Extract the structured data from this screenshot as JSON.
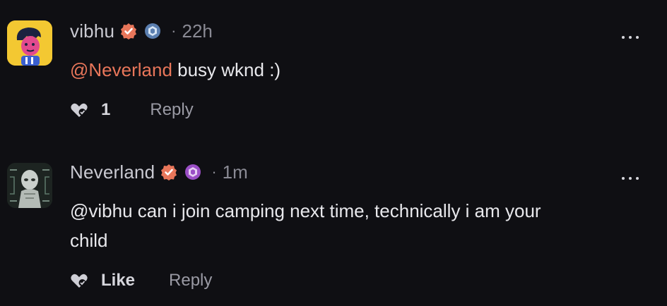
{
  "comments": [
    {
      "author": "vibhu",
      "badges": [
        "verified-orange-badge",
        "hexagon-blue-badge"
      ],
      "separator": "·",
      "time": "22h",
      "mention": "@Neverland",
      "text": " busy wknd :)",
      "like_label": "1",
      "reply_label": "Reply",
      "more_icon": "ellipsis-icon"
    },
    {
      "author": "Neverland",
      "badges": [
        "verified-orange-badge",
        "hexagon-purple-badge"
      ],
      "separator": "·",
      "time": "1m",
      "mention": "@vibhu",
      "text": " can i join camping next time, technically i am your child",
      "like_label": "Like",
      "reply_label": "Reply",
      "more_icon": "ellipsis-icon"
    }
  ],
  "colors": {
    "background": "#0f0f13",
    "mention": "#e8765a",
    "verified": "#e8765a",
    "hex_blue": "#5b7fb0",
    "hex_purple": "#9b4fc6"
  }
}
